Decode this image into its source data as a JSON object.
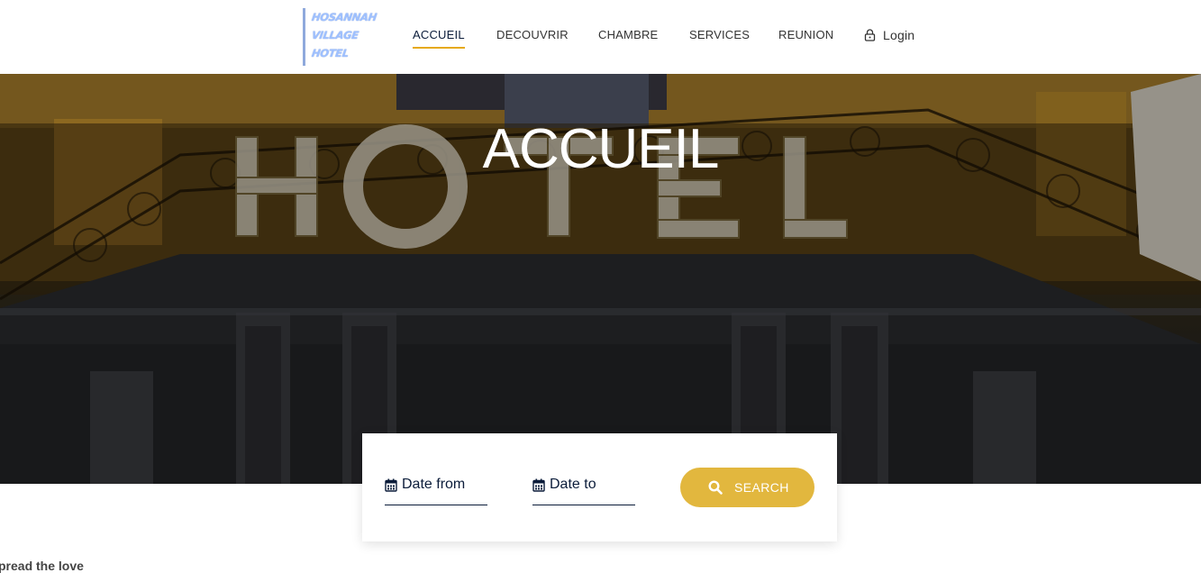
{
  "logo": {
    "lines": [
      "HOSANNAH",
      "VILLAGE",
      "HOTEL"
    ]
  },
  "nav": {
    "items": [
      {
        "label": "ACCUEIL",
        "active": true
      },
      {
        "label": "DECOUVRIR",
        "active": false
      },
      {
        "label": "CHAMBRE",
        "active": false
      },
      {
        "label": "SERVICES",
        "active": false
      },
      {
        "label": "REUNION",
        "active": false
      }
    ],
    "login_label": "Login",
    "login_icon": "lock-icon"
  },
  "hero": {
    "title": "ACCUEIL"
  },
  "booking": {
    "date_from": "Date from",
    "date_to": "Date to",
    "date_icon": "calendar-icon",
    "search_label": "SEARCH",
    "search_icon": "search-icon"
  },
  "footer_teaser": {
    "text": "pread the love"
  },
  "colors": {
    "accent": "#e2b73e",
    "nav_active_underline": "#e6a917",
    "navy": "#0b1c3a",
    "logo_blue": "#9ec0ff"
  }
}
